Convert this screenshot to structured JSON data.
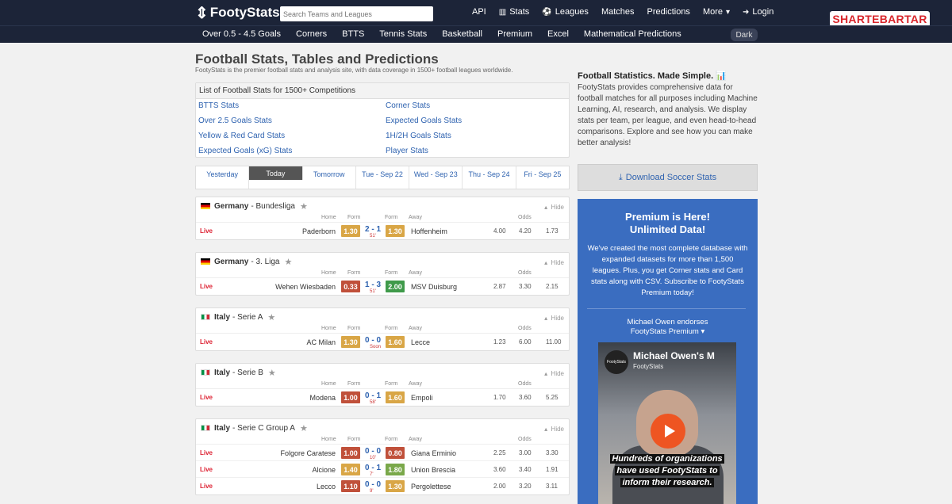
{
  "topbar": {
    "logo": "FootyStats",
    "search_placeholder": "Search Teams and Leagues",
    "nav": [
      {
        "label": "API",
        "icon": ""
      },
      {
        "label": "Stats",
        "icon": "chart-icon"
      },
      {
        "label": "Leagues",
        "icon": "ball-icon"
      },
      {
        "label": "Matches",
        "icon": ""
      },
      {
        "label": "Predictions",
        "icon": ""
      },
      {
        "label": "More",
        "icon": "chevron-down-icon"
      },
      {
        "label": "Login",
        "icon": "login-icon"
      }
    ],
    "brand_logo": "SHARTEBARTAR"
  },
  "subnav": {
    "items": [
      "Over 0.5 - 4.5 Goals",
      "Corners",
      "BTTS",
      "Tennis Stats",
      "Basketball",
      "Premium",
      "Excel",
      "Mathematical Predictions"
    ],
    "dark_label": "Dark"
  },
  "main": {
    "title": "Football Stats, Tables and Predictions",
    "subtitle": "FootyStats is the premier football stats and analysis site, with data coverage in 1500+ football leagues worldwide.",
    "stats_box": {
      "header": "List of Football Stats for 1500+ Competitions",
      "links": [
        "BTTS Stats",
        "Corner Stats",
        "Over 2.5 Goals Stats",
        "Expected Goals Stats",
        "Yellow & Red Card Stats",
        "1H/2H Goals Stats",
        "Expected Goals (xG) Stats",
        "Player Stats"
      ]
    },
    "date_tabs": [
      "Yesterday",
      "Today",
      "Tomorrow",
      "Tue - Sep 22",
      "Wed - Sep 23",
      "Thu - Sep 24",
      "Fri - Sep 25"
    ],
    "col_headers": {
      "home": "Home",
      "form": "Form",
      "form2": "Form",
      "away": "Away",
      "odds": "Odds"
    },
    "hide_label": "Hide",
    "live_label": "Live",
    "leagues": [
      {
        "country": "Germany",
        "name": "Bundesliga",
        "flag": "de",
        "matches": [
          {
            "home": "Paderborn",
            "hf": "1.30",
            "hc": "#d9a646",
            "score": "2 - 1",
            "min": "51'",
            "af": "1.30",
            "ac": "#d9a646",
            "away": "Hoffenheim",
            "o1": "4.00",
            "o2": "4.20",
            "o3": "1.73"
          }
        ]
      },
      {
        "country": "Germany",
        "name": "3. Liga",
        "flag": "de",
        "matches": [
          {
            "home": "Wehen Wiesbaden",
            "hf": "0.33",
            "hc": "#c0503a",
            "score": "1 - 3",
            "min": "51'",
            "af": "2.00",
            "ac": "#3f9a4a",
            "away": "MSV Duisburg",
            "o1": "2.87",
            "o2": "3.30",
            "o3": "2.15"
          }
        ]
      },
      {
        "country": "Italy",
        "name": "Serie A",
        "flag": "it",
        "matches": [
          {
            "home": "AC Milan",
            "hf": "1.30",
            "hc": "#d9a646",
            "score": "0 - 0",
            "min": "Soon",
            "af": "1.60",
            "ac": "#d9a646",
            "away": "Lecce",
            "o1": "1.23",
            "o2": "6.00",
            "o3": "11.00"
          }
        ]
      },
      {
        "country": "Italy",
        "name": "Serie B",
        "flag": "it",
        "matches": [
          {
            "home": "Modena",
            "hf": "1.00",
            "hc": "#c0503a",
            "score": "0 - 1",
            "min": "58'",
            "af": "1.60",
            "ac": "#d9a646",
            "away": "Empoli",
            "o1": "1.70",
            "o2": "3.60",
            "o3": "5.25"
          }
        ]
      },
      {
        "country": "Italy",
        "name": "Serie C Group A",
        "flag": "it",
        "matches": [
          {
            "home": "Folgore Caratese",
            "hf": "1.00",
            "hc": "#c0503a",
            "score": "0 - 0",
            "min": "10'",
            "af": "0.80",
            "ac": "#c0503a",
            "away": "Giana Erminio",
            "o1": "2.25",
            "o2": "3.00",
            "o3": "3.30"
          },
          {
            "home": "Alcione",
            "hf": "1.40",
            "hc": "#d9a646",
            "score": "0 - 1",
            "min": "7'",
            "af": "1.80",
            "ac": "#7aa84a",
            "away": "Union Brescia",
            "o1": "3.60",
            "o2": "3.40",
            "o3": "1.91"
          },
          {
            "home": "Lecco",
            "hf": "1.10",
            "hc": "#c0503a",
            "score": "0 - 0",
            "min": "9'",
            "af": "1.30",
            "ac": "#d9a646",
            "away": "Pergolettese",
            "o1": "2.00",
            "o2": "3.20",
            "o3": "3.11"
          }
        ]
      }
    ]
  },
  "sidebar": {
    "title": "Football Statistics. Made Simple.",
    "text": "FootyStats provides comprehensive data for football matches for all purposes including Machine Learning, AI, research, and analysis. We display stats per team, per league, and even head-to-head comparisons. Explore and see how you can make better analysis!",
    "download_label": "Download Soccer Stats",
    "premium": {
      "title_line1": "Premium is Here!",
      "title_line2": "Unlimited Data!",
      "text": "We've created the most complete database with expanded datasets for more than 1,500 leagues. Plus, you get Corner stats and Card stats along with CSV. Subscribe to FootyStats Premium today!",
      "endorse_line1": "Michael Owen endorses",
      "endorse_line2": "FootyStats Premium",
      "video_title": "Michael Owen's M",
      "video_channel": "FootyStats",
      "video_logo": "FootyStats",
      "video_caption": "Hundreds of organizations have used FootyStats to inform their research."
    }
  }
}
